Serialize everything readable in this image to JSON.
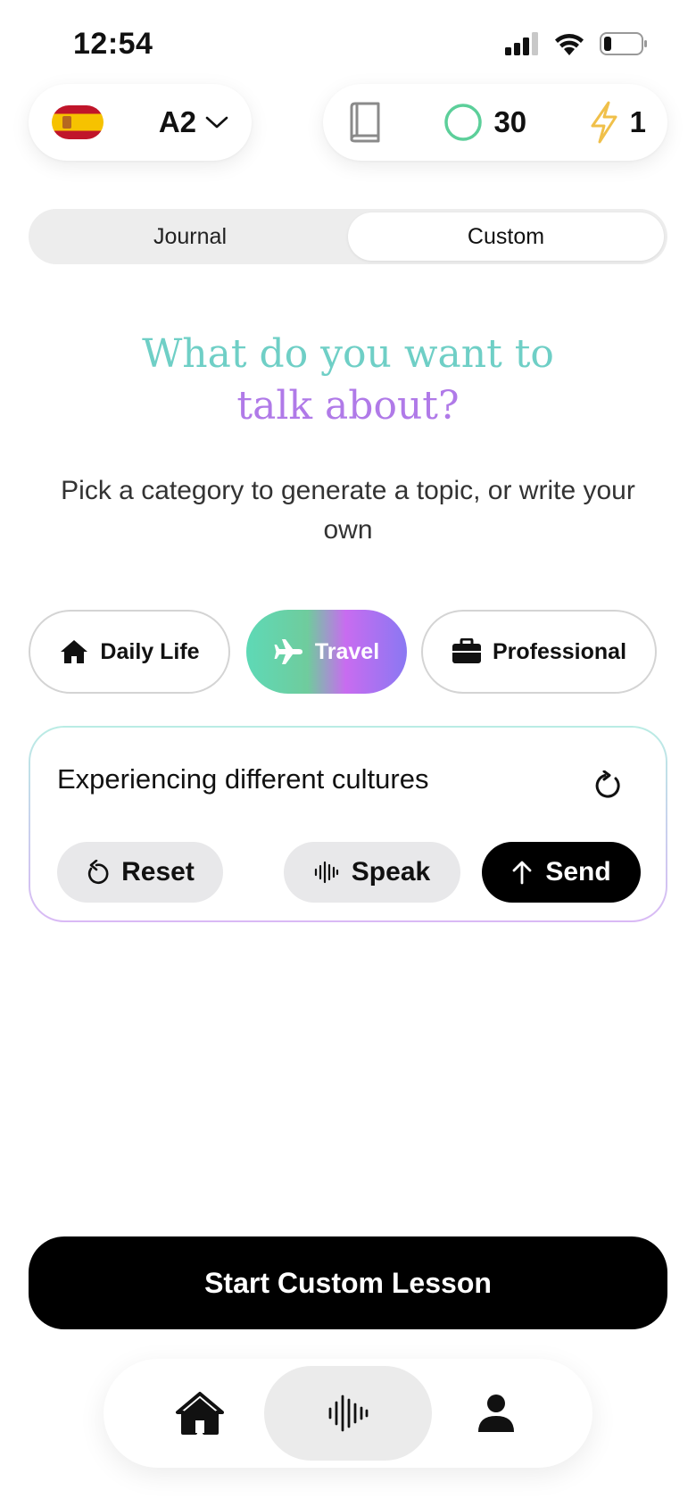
{
  "status_bar": {
    "time": "12:54",
    "icons": [
      "cellular-signal-icon",
      "wifi-icon",
      "battery-icon"
    ]
  },
  "language": {
    "flag": "spain-flag",
    "level": "A2"
  },
  "stats": {
    "book_icon": "book-icon",
    "points": "30",
    "streak": "1",
    "points_color": "#5ccf9a",
    "streak_color": "#f0c04a"
  },
  "tabs": [
    {
      "label": "Journal",
      "active": false
    },
    {
      "label": "Custom",
      "active": true
    }
  ],
  "headline": {
    "line1": "What do you want to",
    "line2": "talk about?"
  },
  "subtitle": "Pick a category to generate a topic, or write your own",
  "categories": [
    {
      "label": "Daily Life",
      "icon": "home-icon",
      "selected": false
    },
    {
      "label": "Travel",
      "icon": "airplane-icon",
      "selected": true
    },
    {
      "label": "Professional",
      "icon": "briefcase-icon",
      "selected": false
    }
  ],
  "topic_card": {
    "topic": "Experiencing different cultures",
    "reset_label": "Reset",
    "speak_label": "Speak",
    "send_label": "Send"
  },
  "start_button": "Start Custom Lesson",
  "bottom_nav": [
    {
      "icon": "home-icon",
      "active": false
    },
    {
      "icon": "voice-wave-icon",
      "active": true
    },
    {
      "icon": "profile-icon",
      "active": false
    }
  ]
}
